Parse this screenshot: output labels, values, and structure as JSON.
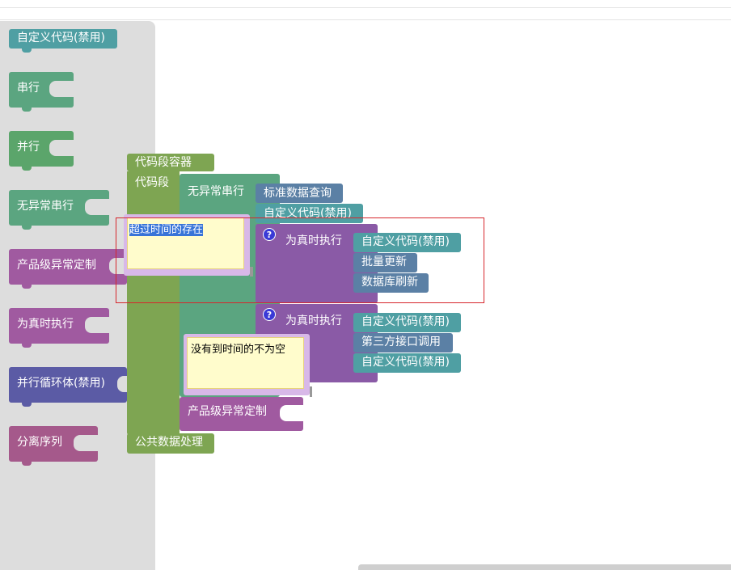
{
  "toolbox": {
    "items": [
      {
        "label": "自定义代码(禁用)",
        "color": "#4f9fa3"
      },
      {
        "label": "串行",
        "color": "#5ba580"
      },
      {
        "label": "并行",
        "color": "#5ba56b"
      },
      {
        "label": "无异常串行",
        "color": "#5ba580"
      },
      {
        "label": "产品级异常定制",
        "color": "#a05aa0"
      },
      {
        "label": "为真时执行",
        "color": "#a05aa0"
      },
      {
        "label": "并行循环体(禁用)",
        "color": "#5b5ba5"
      },
      {
        "label": "分离序列",
        "color": "#a5598b"
      }
    ]
  },
  "workspace": {
    "container_title": "代码段容器",
    "segment_label": "代码段",
    "footer_label": "公共数据处理",
    "serial_label": "无异常串行",
    "query_label": "标准数据查询",
    "custom_code_disabled": "自定义代码(禁用)",
    "cond1_label": "为真时执行",
    "cond1_items": [
      "自定义代码(禁用)",
      "批量更新",
      "数据库刷新"
    ],
    "cond2_label": "为真时执行",
    "cond2_items": [
      "自定义代码(禁用)",
      "第三方接口调用",
      "自定义代码(禁用)"
    ],
    "exception_label": "产品级异常定制",
    "comment1_text": "超过时间的存在",
    "comment2_text": "没有到时间的不为空",
    "help_glyph": "?"
  },
  "colors": {
    "toolbox_bg": "#dddddd",
    "selection_box": "#d6262c",
    "comment_bg": "#fffccc"
  }
}
